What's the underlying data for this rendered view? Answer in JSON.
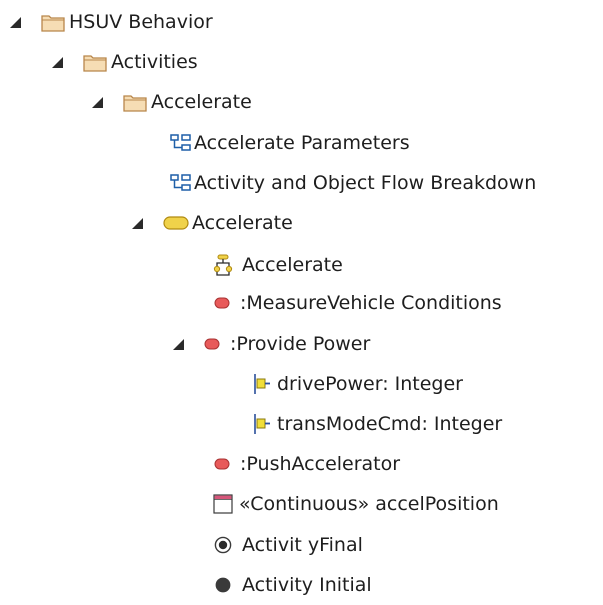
{
  "tree": {
    "nodes": [
      {
        "label": "HSUV Behavior",
        "icon": "folder-icon",
        "expanded": true
      },
      {
        "label": "Activities",
        "icon": "folder-icon",
        "expanded": true
      },
      {
        "label": "Accelerate",
        "icon": "folder-icon",
        "expanded": true
      },
      {
        "label": "Accelerate Parameters",
        "icon": "diagram-icon"
      },
      {
        "label": "Activity and Object Flow Breakdown",
        "icon": "diagram-icon"
      },
      {
        "label": "Accelerate",
        "icon": "activity-icon",
        "expanded": true
      },
      {
        "label": "Accelerate",
        "icon": "activity-diagram-icon"
      },
      {
        "label": ":MeasureVehicle Conditions",
        "icon": "action-icon"
      },
      {
        "label": ":Provide Power",
        "icon": "action-icon",
        "expanded": true
      },
      {
        "label": "drivePower: Integer",
        "icon": "pin-icon"
      },
      {
        "label": "transModeCmd: Integer",
        "icon": "pin-icon"
      },
      {
        "label": ":PushAccelerator",
        "icon": "action-icon"
      },
      {
        "label": "«Continuous» accelPosition",
        "icon": "object-node-icon"
      },
      {
        "label": "Activit yFinal",
        "icon": "final-node-icon"
      },
      {
        "label": "Activity Initial",
        "icon": "initial-node-icon"
      }
    ]
  },
  "colors": {
    "folder_fill": "#f6ddb4",
    "folder_stroke": "#b8864b",
    "diagram_blue": "#1e5fa8",
    "activity_fill": "#f0d24a",
    "activity_stroke": "#b08a10",
    "action_fill": "#e85a5a",
    "action_stroke": "#a83232",
    "pin_yellow": "#f0de3a",
    "pin_blue": "#2a4f9a",
    "object_bar": "#d6567a",
    "text": "#1e1e1e"
  }
}
